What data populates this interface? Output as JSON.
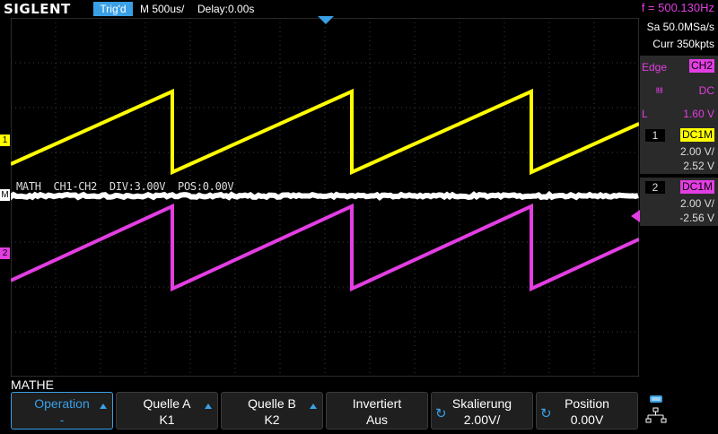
{
  "header": {
    "brand": "SIGLENT",
    "trigger_status": "Trig'd",
    "timebase": "M 500us/",
    "delay": "Delay:0.00s",
    "frequency": "f = 500.130Hz"
  },
  "acquisition": {
    "sample_rate": "Sa 50.0MSa/s",
    "memory_depth": "Curr 350kpts"
  },
  "trigger": {
    "type": "Edge",
    "source": "CH2",
    "coupling": "DC",
    "level_label": "L",
    "level": "1.60 V"
  },
  "channels": [
    {
      "number": "1",
      "coupling": "DC1M",
      "scale": "2.00 V/",
      "offset": "2.52 V",
      "color": "#ffff00"
    },
    {
      "number": "2",
      "coupling": "DC1M",
      "scale": "2.00 V/",
      "offset": "-2.56 V",
      "color": "#e23ee2"
    }
  ],
  "math": {
    "marker": "M",
    "label": "MATH  CH1-CH2  DIV:3.00V  POS:0.00V"
  },
  "markers": {
    "ch1": "1",
    "ch2": "2"
  },
  "menu": {
    "title": "MATHE",
    "softkeys": [
      {
        "label": "Operation",
        "value": "-"
      },
      {
        "label": "Quelle A",
        "value": "K1"
      },
      {
        "label": "Quelle B",
        "value": "K2"
      },
      {
        "label": "Invertiert",
        "value": "Aus"
      },
      {
        "label": "Skalierung",
        "value": "2.00V/"
      },
      {
        "label": "Position",
        "value": "0.00V"
      }
    ]
  },
  "colors": {
    "accent": "#3aa0e6",
    "ch1": "#ffff00",
    "ch2": "#e23ee2",
    "math": "#ffffff"
  }
}
